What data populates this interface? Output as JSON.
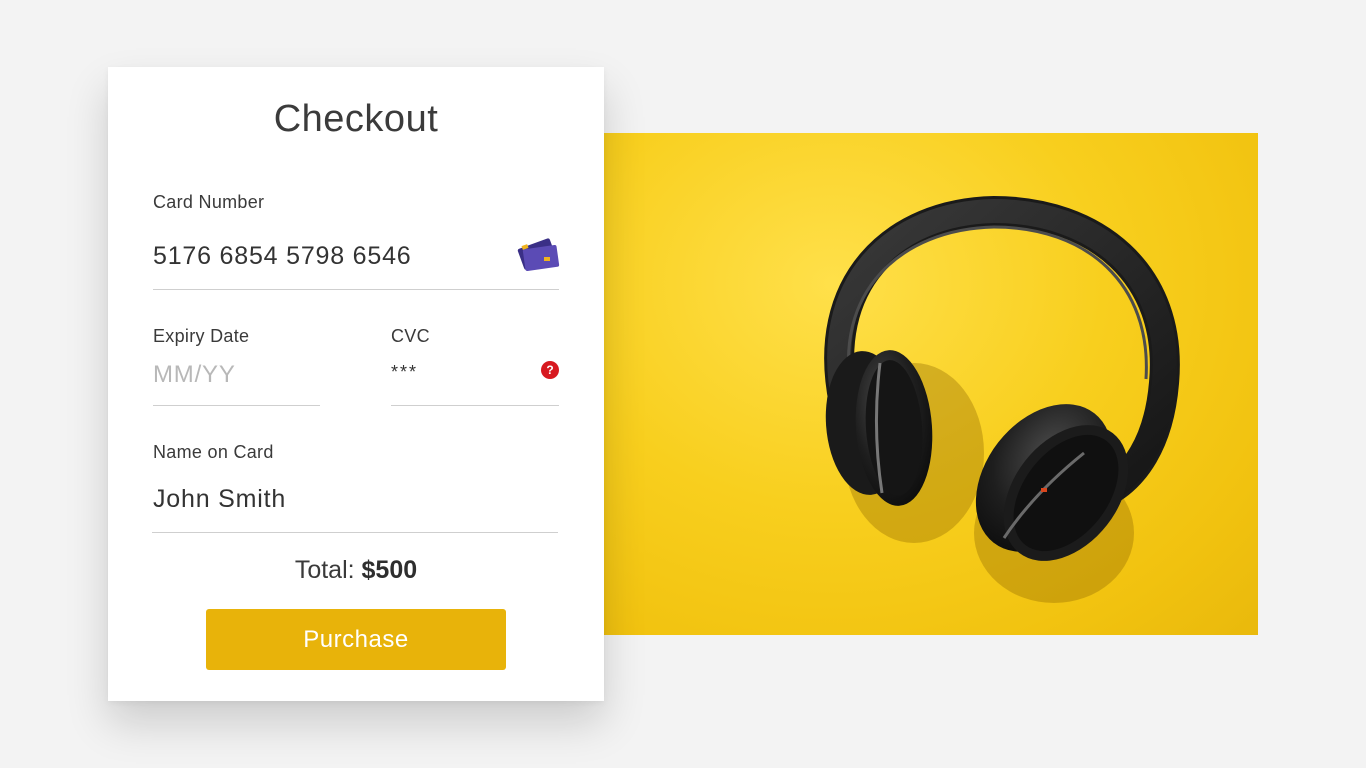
{
  "checkout": {
    "title": "Checkout",
    "card_number": {
      "label": "Card Number",
      "value": "5176 6854 5798 6546",
      "icon": "credit-card-icon"
    },
    "expiry": {
      "label": "Expiry Date",
      "placeholder": "MM/YY",
      "value": ""
    },
    "cvc": {
      "label": "CVC",
      "value": "***",
      "help_icon": "help-icon",
      "help_symbol": "?"
    },
    "name_on_card": {
      "label": "Name on Card",
      "value": "John Smith"
    },
    "total": {
      "label": "Total:",
      "amount": "$500"
    },
    "purchase_label": "Purchase"
  },
  "product_image": {
    "subject": "headphones"
  },
  "colors": {
    "background": "#f3f3f3",
    "accent": "#e8b30a",
    "product_bg": "#f8cf1e",
    "help_icon": "#d71920",
    "card_icon": "#4b3f9a"
  }
}
